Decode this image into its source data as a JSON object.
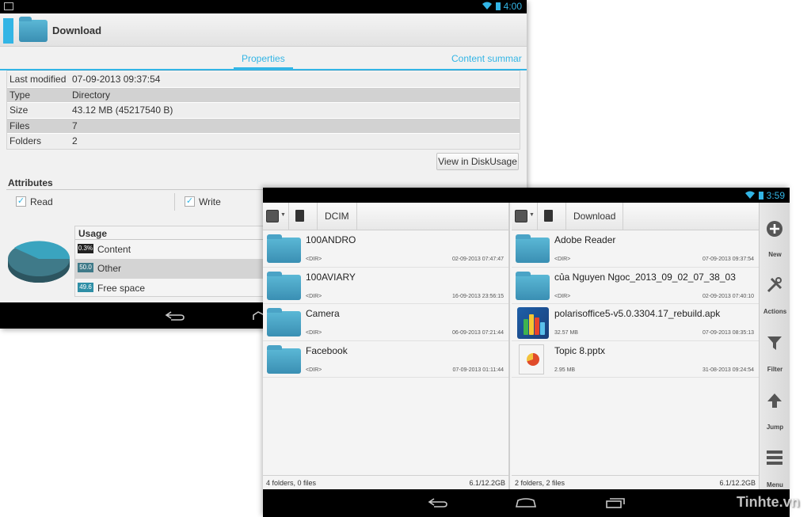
{
  "back_window": {
    "status_time": "4:00",
    "title": "Download",
    "tabs": [
      "Properties",
      "Content summar"
    ],
    "properties": [
      {
        "key": "Last modified",
        "value": "07-09-2013 09:37:54"
      },
      {
        "key": "Type",
        "value": "Directory"
      },
      {
        "key": "Size",
        "value": "43.12 MB (45217540 B)"
      },
      {
        "key": "Files",
        "value": "7"
      },
      {
        "key": "Folders",
        "value": "2"
      }
    ],
    "diskusage_button": "View in DiskUsage",
    "attributes": {
      "header": "Attributes",
      "read_label": "Read",
      "read_checked": true,
      "write_label": "Write",
      "write_checked": true
    },
    "usage": {
      "header": "Usage",
      "rows": [
        {
          "badge": "0.3%",
          "label": "Content",
          "color": "#222222"
        },
        {
          "badge": "50.0",
          "label": "Other",
          "color": "#3f7a89"
        },
        {
          "badge": "49.6",
          "label": "Free space",
          "color": "#2f8fa6"
        }
      ]
    }
  },
  "front_window": {
    "status_time": "3:59",
    "left_pane": {
      "crumb": "DCIM",
      "items": [
        {
          "name": "100ANDRO",
          "meta": "<DIR>",
          "date": "02-09-2013 07:47:47"
        },
        {
          "name": "100AVIARY",
          "meta": "<DIR>",
          "date": "16-09-2013 23:56:15"
        },
        {
          "name": "Camera",
          "meta": "<DIR>",
          "date": "06-09-2013 07:21:44"
        },
        {
          "name": "Facebook",
          "meta": "<DIR>",
          "date": "07-09-2013 01:11:44"
        }
      ],
      "footer_left": "4 folders, 0 files",
      "footer_right": "6.1/12.2GB"
    },
    "right_pane": {
      "crumb": "Download",
      "items": [
        {
          "name": "Adobe Reader",
          "meta": "<DIR>",
          "date": "07-09-2013 09:37:54",
          "icon": "folder-icon"
        },
        {
          "name": "của Nguyen Ngoc_2013_09_02_07_38_03",
          "meta": "<DIR>",
          "date": "02-09-2013 07:40:10",
          "icon": "folder-icon"
        },
        {
          "name": "polarisoffice5-v5.0.3304.17_rebuild.apk",
          "meta": "32.57 MB",
          "date": "07-09-2013 08:35:13",
          "icon": "apk-icon"
        },
        {
          "name": "Topic 8.pptx",
          "meta": "2.95 MB",
          "date": "31-08-2013 09:24:54",
          "icon": "pptx-icon"
        }
      ],
      "footer_left": "2 folders, 2 files",
      "footer_right": "6.1/12.2GB"
    },
    "toolbar": [
      {
        "label": "New",
        "icon": "plus-circle-icon"
      },
      {
        "label": "Actions",
        "icon": "tools-icon"
      },
      {
        "label": "Filter",
        "icon": "funnel-icon"
      },
      {
        "label": "Jump",
        "icon": "up-arrow-icon"
      },
      {
        "label": "Menu",
        "icon": "menu-icon"
      }
    ]
  },
  "watermark": "Tinhte.vn",
  "colors": {
    "accent": "#33b5e5",
    "folder": "#4aa3c6"
  }
}
